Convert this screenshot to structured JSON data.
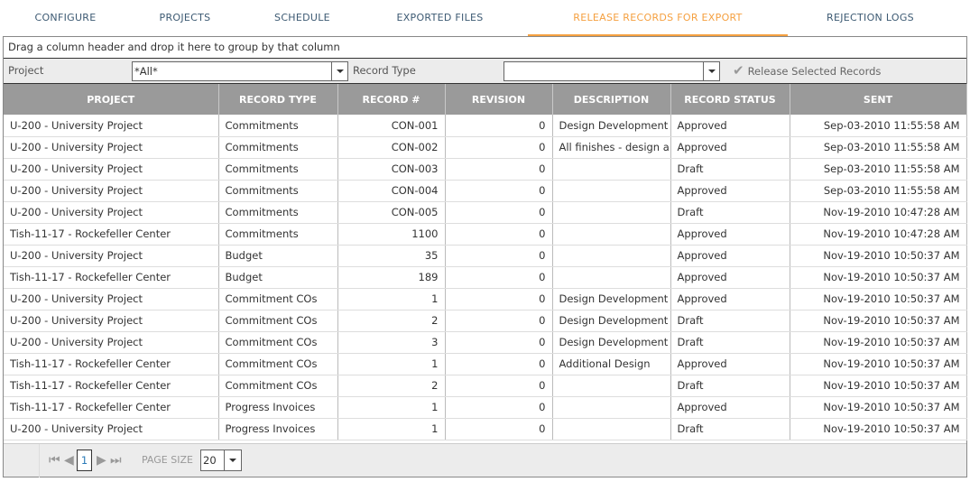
{
  "tabs": [
    {
      "label": "CONFIGURE"
    },
    {
      "label": "PROJECTS"
    },
    {
      "label": "SCHEDULE"
    },
    {
      "label": "EXPORTED FILES"
    },
    {
      "label": "RELEASE RECORDS FOR EXPORT",
      "active": true
    },
    {
      "label": "REJECTION LOGS"
    }
  ],
  "accent": "#f5a040",
  "group_hint": "Drag a column header and drop it here to group by that column",
  "filter": {
    "project_label": "Project",
    "project_value": "*All*",
    "record_type_label": "Record Type",
    "record_type_value": "",
    "release_label": "Release Selected Records",
    "release_icon": "checkmark-icon"
  },
  "columns": [
    "PROJECT",
    "RECORD TYPE",
    "RECORD #",
    "REVISION",
    "DESCRIPTION",
    "RECORD STATUS",
    "SENT"
  ],
  "rows": [
    [
      "U-200 - University Project",
      "Commitments",
      "CON-001",
      "0",
      "Design Development",
      "Approved",
      "Sep-03-2010 11:55:58 AM"
    ],
    [
      "U-200 - University Project",
      "Commitments",
      "CON-002",
      "0",
      "All finishes - design a",
      "Approved",
      "Sep-03-2010 11:55:58 AM"
    ],
    [
      "U-200 - University Project",
      "Commitments",
      "CON-003",
      "0",
      "",
      "Draft",
      "Sep-03-2010 11:55:58 AM"
    ],
    [
      "U-200 - University Project",
      "Commitments",
      "CON-004",
      "0",
      "",
      "Approved",
      "Sep-03-2010 11:55:58 AM"
    ],
    [
      "U-200 - University Project",
      "Commitments",
      "CON-005",
      "0",
      "",
      "Draft",
      "Nov-19-2010 10:47:28 AM"
    ],
    [
      "Tish-11-17 - Rockefeller Center",
      "Commitments",
      "1100",
      "0",
      "",
      "Approved",
      "Nov-19-2010 10:47:28 AM"
    ],
    [
      "U-200 - University Project",
      "Budget",
      "35",
      "0",
      "",
      "Approved",
      "Nov-19-2010 10:50:37 AM"
    ],
    [
      "Tish-11-17 - Rockefeller Center",
      "Budget",
      "189",
      "0",
      "",
      "Approved",
      "Nov-19-2010 10:50:37 AM"
    ],
    [
      "U-200 - University Project",
      "Commitment COs",
      "1",
      "0",
      "Design Development",
      "Approved",
      "Nov-19-2010 10:50:37 AM"
    ],
    [
      "U-200 - University Project",
      "Commitment COs",
      "2",
      "0",
      "Design Development",
      "Draft",
      "Nov-19-2010 10:50:37 AM"
    ],
    [
      "U-200 - University Project",
      "Commitment COs",
      "3",
      "0",
      "Design Development",
      "Draft",
      "Nov-19-2010 10:50:37 AM"
    ],
    [
      "Tish-11-17 - Rockefeller Center",
      "Commitment COs",
      "1",
      "0",
      "Additional Design",
      "Approved",
      "Nov-19-2010 10:50:37 AM"
    ],
    [
      "Tish-11-17 - Rockefeller Center",
      "Commitment COs",
      "2",
      "0",
      "",
      "Draft",
      "Nov-19-2010 10:50:37 AM"
    ],
    [
      "Tish-11-17 - Rockefeller Center",
      "Progress Invoices",
      "1",
      "0",
      "",
      "Approved",
      "Nov-19-2010 10:50:37 AM"
    ],
    [
      "U-200 - University Project",
      "Progress Invoices",
      "1",
      "0",
      "",
      "Draft",
      "Nov-19-2010 10:50:37 AM"
    ]
  ],
  "pager": {
    "page": "1",
    "page_size_label": "PAGE SIZE",
    "page_size": "20"
  }
}
